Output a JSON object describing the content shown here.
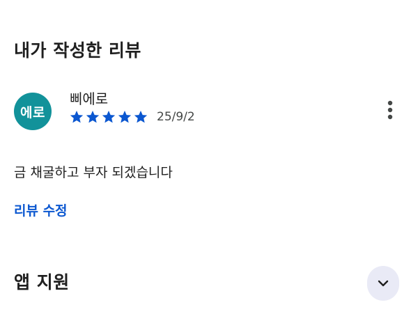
{
  "review_section": {
    "title": "내가 작성한 리뷰"
  },
  "review": {
    "avatar_text": "에로",
    "avatar_color": "#12929a",
    "reviewer_name": "삐에로",
    "rating": 5,
    "rating_max": 5,
    "star_color": "#0b57d0",
    "date": "25/9/2",
    "text": "금 채굴하고 부자 되겠습니다",
    "more_icon": "more-vert-icon"
  },
  "actions": {
    "edit_label": "리뷰 수정",
    "edit_color": "#0b57d0"
  },
  "support_section": {
    "title": "앱 지원",
    "expand_icon": "chevron-down-icon"
  }
}
